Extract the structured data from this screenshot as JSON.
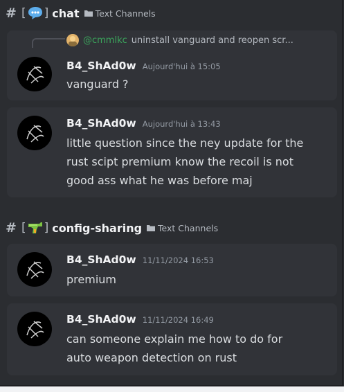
{
  "sections": [
    {
      "hash": "#",
      "emoji_icon": "speech-bubble-icon",
      "channel": "chat",
      "category": "Text Channels",
      "messages": [
        {
          "reply": {
            "user": "@cmmlkc",
            "text": "uninstall vanguard and reopen scr..."
          },
          "author": "B4_ShAd0w",
          "time": "Aujourd'hui à 15:05",
          "lines": [
            "vanguard ?"
          ]
        },
        {
          "author": "B4_ShAd0w",
          "time": "Aujourd'hui à 13:43",
          "lines": [
            "little question since the ney update for the",
            "rust scipt premium know the recoil is not",
            "good ass what he was before maj"
          ]
        }
      ]
    },
    {
      "hash": "#",
      "emoji_icon": "water-pistol-icon",
      "channel": "config-sharing",
      "category": "Text Channels",
      "messages": [
        {
          "author": "B4_ShAd0w",
          "time": "11/11/2024 16:53",
          "lines": [
            "premium"
          ]
        },
        {
          "author": "B4_ShAd0w",
          "time": "11/11/2024 16:49",
          "lines": [
            "can someone explain me how to do for",
            "auto weapon detection on rust"
          ]
        }
      ]
    }
  ],
  "colors": {
    "background": "#2b2d31",
    "card": "#313338",
    "username": "#f2f3f5",
    "timestamp": "#949ba4",
    "mention": "#3ba55c"
  }
}
